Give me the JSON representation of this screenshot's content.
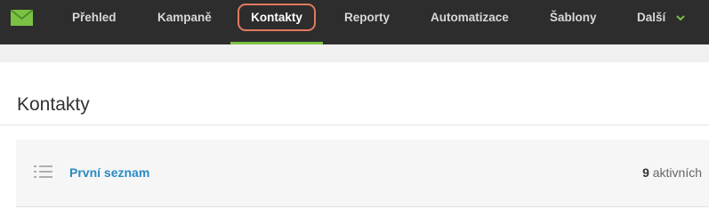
{
  "nav": {
    "items": [
      {
        "label": "Přehled"
      },
      {
        "label": "Kampaně"
      },
      {
        "label": "Kontakty",
        "active": true
      },
      {
        "label": "Reporty"
      },
      {
        "label": "Automatizace"
      },
      {
        "label": "Šablony"
      },
      {
        "label": "Další"
      }
    ],
    "accent_color": "#7bc143",
    "highlight_color": "#e07a5f"
  },
  "page": {
    "title": "Kontakty"
  },
  "lists": [
    {
      "name": "První seznam",
      "count": "9",
      "count_label": "aktivních"
    }
  ],
  "icons": {
    "logo": "envelope-logo-icon",
    "dropdown": "chevron-down-icon",
    "list": "list-icon"
  }
}
